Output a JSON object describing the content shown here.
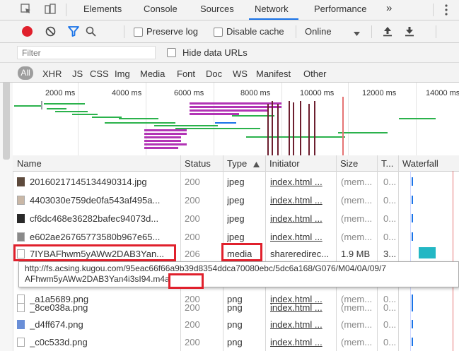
{
  "tabs": [
    {
      "label": "Elements",
      "active": false
    },
    {
      "label": "Console",
      "active": false
    },
    {
      "label": "Sources",
      "active": false
    },
    {
      "label": "Network",
      "active": true
    },
    {
      "label": "Performance",
      "active": false
    }
  ],
  "toolbar": {
    "preserve_log": "Preserve log",
    "disable_cache": "Disable cache",
    "throttle": "Online"
  },
  "filter": {
    "placeholder": "Filter",
    "hide_data_urls": "Hide data URLs"
  },
  "type_filters": [
    "All",
    "XHR",
    "JS",
    "CSS",
    "Img",
    "Media",
    "Font",
    "Doc",
    "WS",
    "Manifest",
    "Other"
  ],
  "overview": {
    "ticks": [
      "2000 ms",
      "4000 ms",
      "6000 ms",
      "8000 ms",
      "10000 ms",
      "12000 ms",
      "14000 ms"
    ]
  },
  "table": {
    "headers": {
      "name": "Name",
      "status": "Status",
      "type": "Type",
      "initiator": "Initiator",
      "size": "Size",
      "time": "T...",
      "waterfall": "Waterfall"
    },
    "rows": [
      {
        "name": "20160217145134490314.jpg",
        "status": "200",
        "type": "jpeg",
        "initiator": "index.html ...",
        "size": "(mem...",
        "time": "0..."
      },
      {
        "name": "4403030e759de0fa543af495a...",
        "status": "200",
        "type": "jpeg",
        "initiator": "index.html ...",
        "size": "(mem...",
        "time": "0..."
      },
      {
        "name": "cf6dc468e36282bafec94073d...",
        "status": "200",
        "type": "jpeg",
        "initiator": "index.html ...",
        "size": "(mem...",
        "time": "0..."
      },
      {
        "name": "e602ae26765773580b967e65...",
        "status": "200",
        "type": "jpeg",
        "initiator": "index.html ...",
        "size": "(mem...",
        "time": "0..."
      },
      {
        "name": "7IYBAFhwm5yAWw2DAB3Yan...",
        "status": "206",
        "type": "media",
        "initiator": "shareredirec...",
        "size": "1.9 MB",
        "time": "3..."
      },
      {
        "name": "_a1a5689.png",
        "status": "200",
        "type": "png",
        "initiator": "index.html ...",
        "size": "(mem...",
        "time": "0..."
      },
      {
        "name": "_8ce038a.png",
        "status": "200",
        "type": "png",
        "initiator": "index.html ...",
        "size": "(mem...",
        "time": "0..."
      },
      {
        "name": "_d4ff674.png",
        "status": "200",
        "type": "png",
        "initiator": "index.html ...",
        "size": "(mem...",
        "time": "0..."
      },
      {
        "name": "_c0c533d.png",
        "status": "200",
        "type": "png",
        "initiator": "index.html ...",
        "size": "(mem...",
        "time": "0..."
      }
    ]
  },
  "tooltip": {
    "line1": "http://fs.acsing.kugou.com/95eac66f66a9b39d8354ddca70080ebc/5dc6a168/G076/M04/0A/09/7",
    "line2_prefix": "AFhwm5yAWw2DAB3Yan4i3sI94",
    "line2_ext": ".m4a"
  },
  "colors": {
    "record": "#e0202c",
    "filter_active": "#1a73e8",
    "highlight": "#e0202c"
  }
}
